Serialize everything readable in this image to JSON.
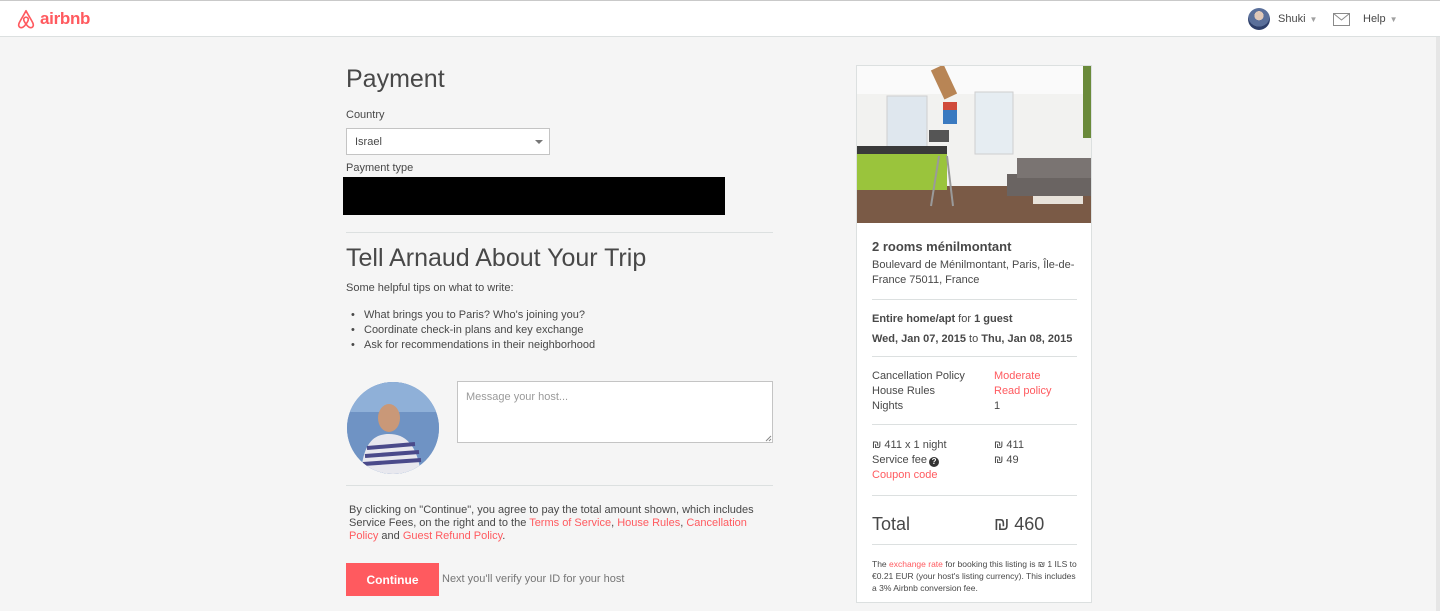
{
  "header": {
    "logo_text": "airbnb",
    "user_name": "Shuki",
    "help_label": "Help",
    "brand_color": "#ff5a5f",
    "icons": [
      "airbnb-logo-icon",
      "avatar",
      "caret-down-icon",
      "mail-icon"
    ]
  },
  "payment": {
    "title": "Payment",
    "country_label": "Country",
    "country_value": "Israel",
    "payment_type_label": "Payment type"
  },
  "trip": {
    "title": "Tell Arnaud About Your Trip",
    "intro": "Some helpful tips on what to write:",
    "tips": [
      "What brings you to Paris? Who's joining you?",
      "Coordinate check-in plans and key exchange",
      "Ask for recommendations in their neighborhood"
    ],
    "message_placeholder": "Message your host..."
  },
  "terms": {
    "part1": "By clicking on \"Continue\", you agree to pay the total amount shown, which includes Service Fees, on the right and to the ",
    "terms_link": "Terms of Service",
    "comma1": ", ",
    "house_rules_link": "House Rules",
    "comma2": ", ",
    "cancellation_link": "Cancellation Policy",
    "and": " and ",
    "refund_link": "Guest Refund Policy",
    "end": "."
  },
  "actions": {
    "continue_label": "Continue",
    "next_note": "Next you'll verify your ID for your host"
  },
  "listing": {
    "name": "2 rooms ménilmontant",
    "address": "Boulevard de Ménilmontant, Paris, Île-de-France 75011, France",
    "room_type": "Entire home/apt",
    "for_text": " for ",
    "guests": "1 guest",
    "checkin": "Wed, Jan 07, 2015",
    "to_text": " to ",
    "checkout": "Thu, Jan 08, 2015",
    "cancellation_label": "Cancellation Policy",
    "cancellation_value": "Moderate",
    "house_rules_label": "House Rules",
    "house_rules_value": "Read policy",
    "nights_label": "Nights",
    "nights_value": "1",
    "rate_label": "₪ 411 x 1 night",
    "rate_value": "₪ 411",
    "service_fee_label": "Service fee",
    "service_fee_value": "₪ 49",
    "coupon_label": "Coupon code",
    "total_label": "Total",
    "total_value": "₪ 460",
    "fine_part1": "The ",
    "fine_link": "exchange rate",
    "fine_part2": " for booking this listing is ₪ 1 ILS to €0.21 EUR (your host's listing currency). This includes a 3% Airbnb conversion fee."
  }
}
